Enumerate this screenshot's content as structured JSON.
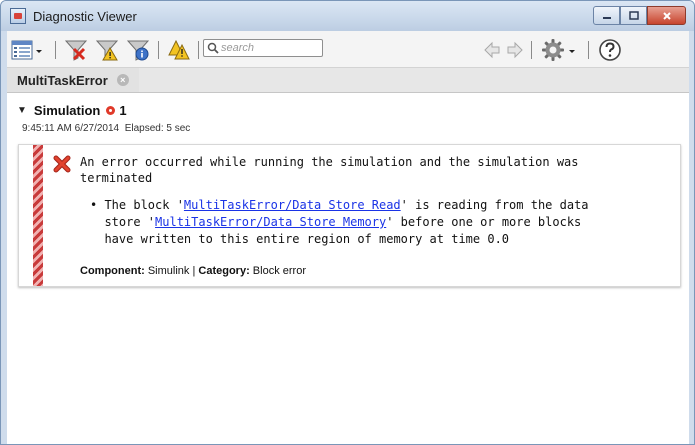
{
  "window": {
    "title": "Diagnostic Viewer",
    "close_label": "x"
  },
  "toolbar": {
    "search": {
      "placeholder": "search",
      "value": ""
    }
  },
  "tab": {
    "label": "MultiTaskError",
    "close_label": "×"
  },
  "simulation": {
    "label": "Simulation",
    "count": "1",
    "timestamp": "9:45:11 AM 6/27/2014",
    "elapsed": "Elapsed: 5 sec"
  },
  "message": {
    "line1": "An error occurred while running the simulation and the simulation was",
    "line2": "terminated",
    "bullet_prefix": "• The block '",
    "link1": "MultiTaskError/Data Store Read",
    "mid1": "' is reading from the data",
    "mid2": "store '",
    "link2": "MultiTaskError/Data Store Memory",
    "mid3": "' before one or more blocks",
    "mid4": "have written to this entire region of memory at time 0.0",
    "component_label": "Component:",
    "component_value": "Simulink",
    "separator": "|",
    "category_label": "Category:",
    "category_value": "Block error"
  },
  "colors": {
    "error": "#e03a2a",
    "link": "#1a33e6",
    "stripe": "#c83a3a"
  },
  "icons": [
    "app-icon",
    "minimize-icon",
    "maximize-icon",
    "close-icon",
    "list-view-icon",
    "dropdown-arrow-icon",
    "filter-error-icon",
    "filter-warning-icon",
    "filter-info-icon",
    "warnings-icon",
    "search-icon",
    "back-arrow-icon",
    "forward-arrow-icon",
    "gear-icon",
    "help-icon",
    "error-x-icon"
  ]
}
